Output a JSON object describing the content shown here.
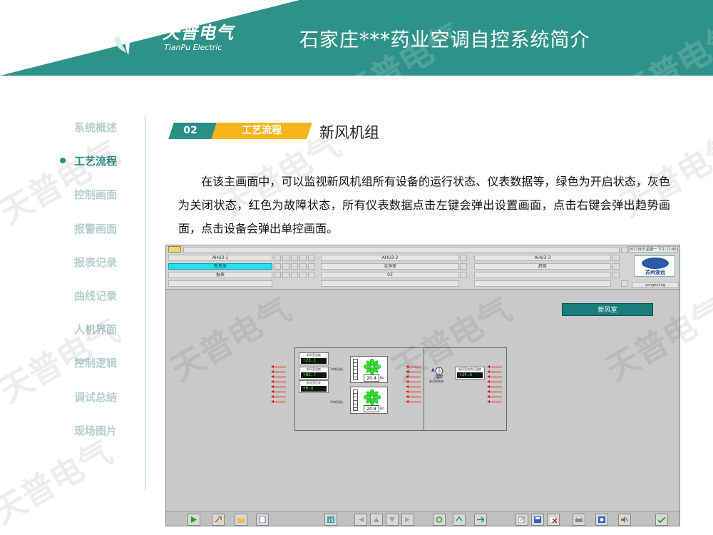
{
  "header": {
    "logo_cn": "天普电气",
    "logo_en": "TianPu Electric",
    "title": "石家庄***药业空调自控系统简介"
  },
  "nav": {
    "items": [
      {
        "label": "系统概述",
        "active": false
      },
      {
        "label": "工艺流程",
        "active": true
      },
      {
        "label": "控制画面",
        "active": false
      },
      {
        "label": "报警画面",
        "active": false
      },
      {
        "label": "报表记录",
        "active": false
      },
      {
        "label": "曲线记录",
        "active": false
      },
      {
        "label": "人机界面",
        "active": false
      },
      {
        "label": "控制逻辑",
        "active": false
      },
      {
        "label": "调试总结",
        "active": false
      },
      {
        "label": "现场图片",
        "active": false
      }
    ]
  },
  "section": {
    "number": "02",
    "tag": "工艺流程",
    "title": "新风机组"
  },
  "description": "在该主画面中，可以监视新风机组所有设备的运行状态、仪表数据等，绿色为开启状态，灰色为关闭状态，红色为故障状态，所有仪表数据点击左键会弹出设置画面，点击右键会弹出趋势画面，点击设备会弹出单控画面。",
  "scada": {
    "tabs_row1": [
      "AHU3-1",
      "AHU3-2",
      "AHU3-3"
    ],
    "tabs_row2": [
      "新风室",
      "洁净室",
      "趋势"
    ],
    "tabs_row3": [
      "报表",
      "03",
      ""
    ],
    "datetime": "2017/8/5 星期一 下午 17:40:0",
    "company_logo_text": "苏州浙远",
    "user": "yonghu1ng",
    "room_button": "新风室",
    "sensors": [
      {
        "label": "新风室温度",
        "value": "+23.1",
        "unit": "℃"
      },
      {
        "label": "新风室湿度",
        "value": "+82.7",
        "unit": "%"
      },
      {
        "label": "新风室压差",
        "value": "+0.8",
        "unit": "Pa"
      },
      {
        "label": "新风室加热后温度",
        "value": "+24.6",
        "unit": "℃"
      }
    ],
    "fans": [
      {
        "label": "1#新风机",
        "freq": "20.4",
        "unit": "Hz"
      },
      {
        "label": "2#新风机",
        "freq": "20.8",
        "unit": "Hz"
      }
    ],
    "heater": {
      "label": "新风加热阀",
      "status": "A",
      "percent": "0.4"
    },
    "colors": {
      "on": "#3cff3c",
      "off": "#c9c9c9",
      "fault": "#e01010",
      "accent": "#2f9289"
    }
  }
}
